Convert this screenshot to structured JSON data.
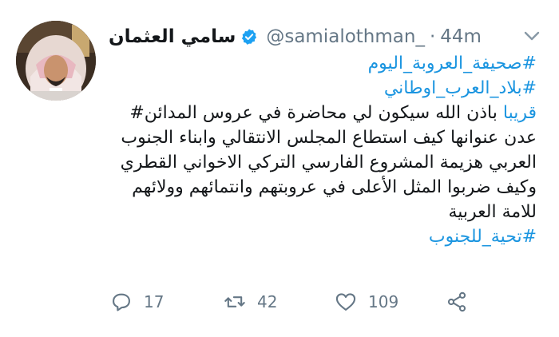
{
  "tweet": {
    "display_name": "سامي العثمان",
    "handle": "@samialothman_",
    "separator": "·",
    "time": "44m",
    "lines": [
      {
        "text": "#صحيفة_العروبة_اليوم",
        "hashtag": true
      },
      {
        "text": "#بلاد_العرب_اوطاني",
        "hashtag": true
      },
      {
        "prefix_hashtag": "قريبا",
        "text": " باذن الله سيكون لي محاضرة في عروس المدائن#",
        "mixed": true
      },
      {
        "text": "عدن عنوانها كيف استطاع المجلس الانتقالي وابناء الجنوب",
        "hashtag": false
      },
      {
        "text": "العربي هزيمة المشروع الفارسي التركي الاخواني القطري",
        "hashtag": false
      },
      {
        "text": "وكيف ضربوا المثل الأعلى في عروبتهم  وانتمائهم وولائهم",
        "hashtag": false
      },
      {
        "text": "للامة العربية",
        "hashtag": false
      },
      {
        "text": "#تحية_للجنوب",
        "hashtag": true
      }
    ]
  },
  "actions": {
    "reply": {
      "icon": "reply-icon",
      "count": "17"
    },
    "retweet": {
      "icon": "retweet-icon",
      "count": "42"
    },
    "like": {
      "icon": "heart-icon",
      "count": "109"
    },
    "share": {
      "icon": "share-icon"
    }
  },
  "colors": {
    "hashtag": "#1b95e0",
    "muted": "#657786",
    "verified": "#1da1f2"
  }
}
